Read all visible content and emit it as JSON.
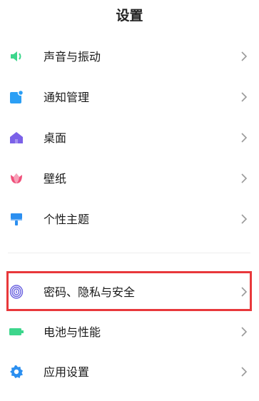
{
  "header": {
    "title": "设置"
  },
  "settings_items": [
    {
      "label": "声音与振动",
      "icon": "speaker-icon",
      "color": "#3dd68c"
    },
    {
      "label": "通知管理",
      "icon": "notification-icon",
      "color": "#2b9ff5"
    },
    {
      "label": "桌面",
      "icon": "home-icon",
      "color": "#7b61e8"
    },
    {
      "label": "壁纸",
      "icon": "tulip-icon",
      "color": "#f0507a"
    },
    {
      "label": "个性主题",
      "icon": "paintbrush-icon",
      "color": "#2b8ff0"
    },
    {
      "label": "密码、隐私与安全",
      "icon": "fingerprint-icon",
      "color": "#6b63e0"
    },
    {
      "label": "电池与性能",
      "icon": "battery-icon",
      "color": "#3dd68c"
    },
    {
      "label": "应用设置",
      "icon": "gear-icon",
      "color": "#2b8ff0"
    }
  ],
  "highlight": {
    "target": "密码、隐私与安全",
    "color": "#e8383b"
  }
}
